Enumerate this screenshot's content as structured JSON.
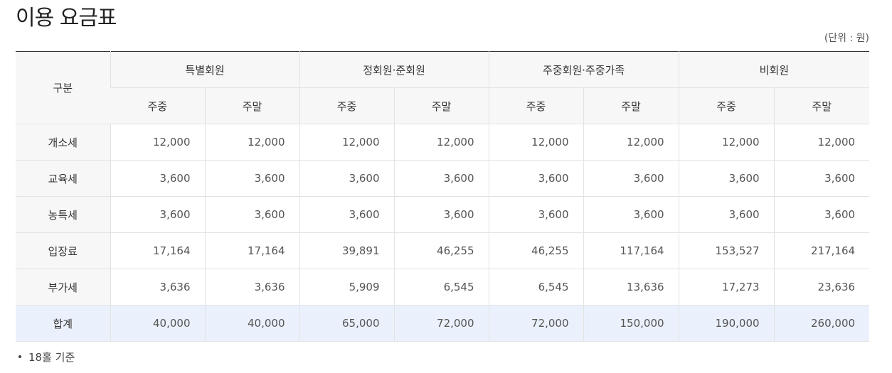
{
  "page": {
    "title": "이용 요금표",
    "unit_note": "(단위 : 원)"
  },
  "table": {
    "category_header": "구분",
    "groups": [
      "특별회원",
      "정회원·준회원",
      "주중회원·주중가족",
      "비회원"
    ],
    "subheaders": [
      "주중",
      "주말",
      "주중",
      "주말",
      "주중",
      "주말",
      "주중",
      "주말"
    ],
    "rows": [
      {
        "label": "개소세",
        "values": [
          "12,000",
          "12,000",
          "12,000",
          "12,000",
          "12,000",
          "12,000",
          "12,000",
          "12,000"
        ]
      },
      {
        "label": "교육세",
        "values": [
          "3,600",
          "3,600",
          "3,600",
          "3,600",
          "3,600",
          "3,600",
          "3,600",
          "3,600"
        ]
      },
      {
        "label": "농특세",
        "values": [
          "3,600",
          "3,600",
          "3,600",
          "3,600",
          "3,600",
          "3,600",
          "3,600",
          "3,600"
        ]
      },
      {
        "label": "입장료",
        "values": [
          "17,164",
          "17,164",
          "39,891",
          "46,255",
          "46,255",
          "117,164",
          "153,527",
          "217,164"
        ]
      },
      {
        "label": "부가세",
        "values": [
          "3,636",
          "3,636",
          "5,909",
          "6,545",
          "6,545",
          "13,636",
          "17,273",
          "23,636"
        ]
      },
      {
        "label": "합계",
        "values": [
          "40,000",
          "40,000",
          "65,000",
          "72,000",
          "72,000",
          "150,000",
          "190,000",
          "260,000"
        ]
      }
    ]
  },
  "footnote": {
    "text": "18홀 기준"
  },
  "colors": {
    "header_bg": "#f7f7f8",
    "total_row_bg": "#ebf1fc",
    "top_border": "#333333"
  }
}
